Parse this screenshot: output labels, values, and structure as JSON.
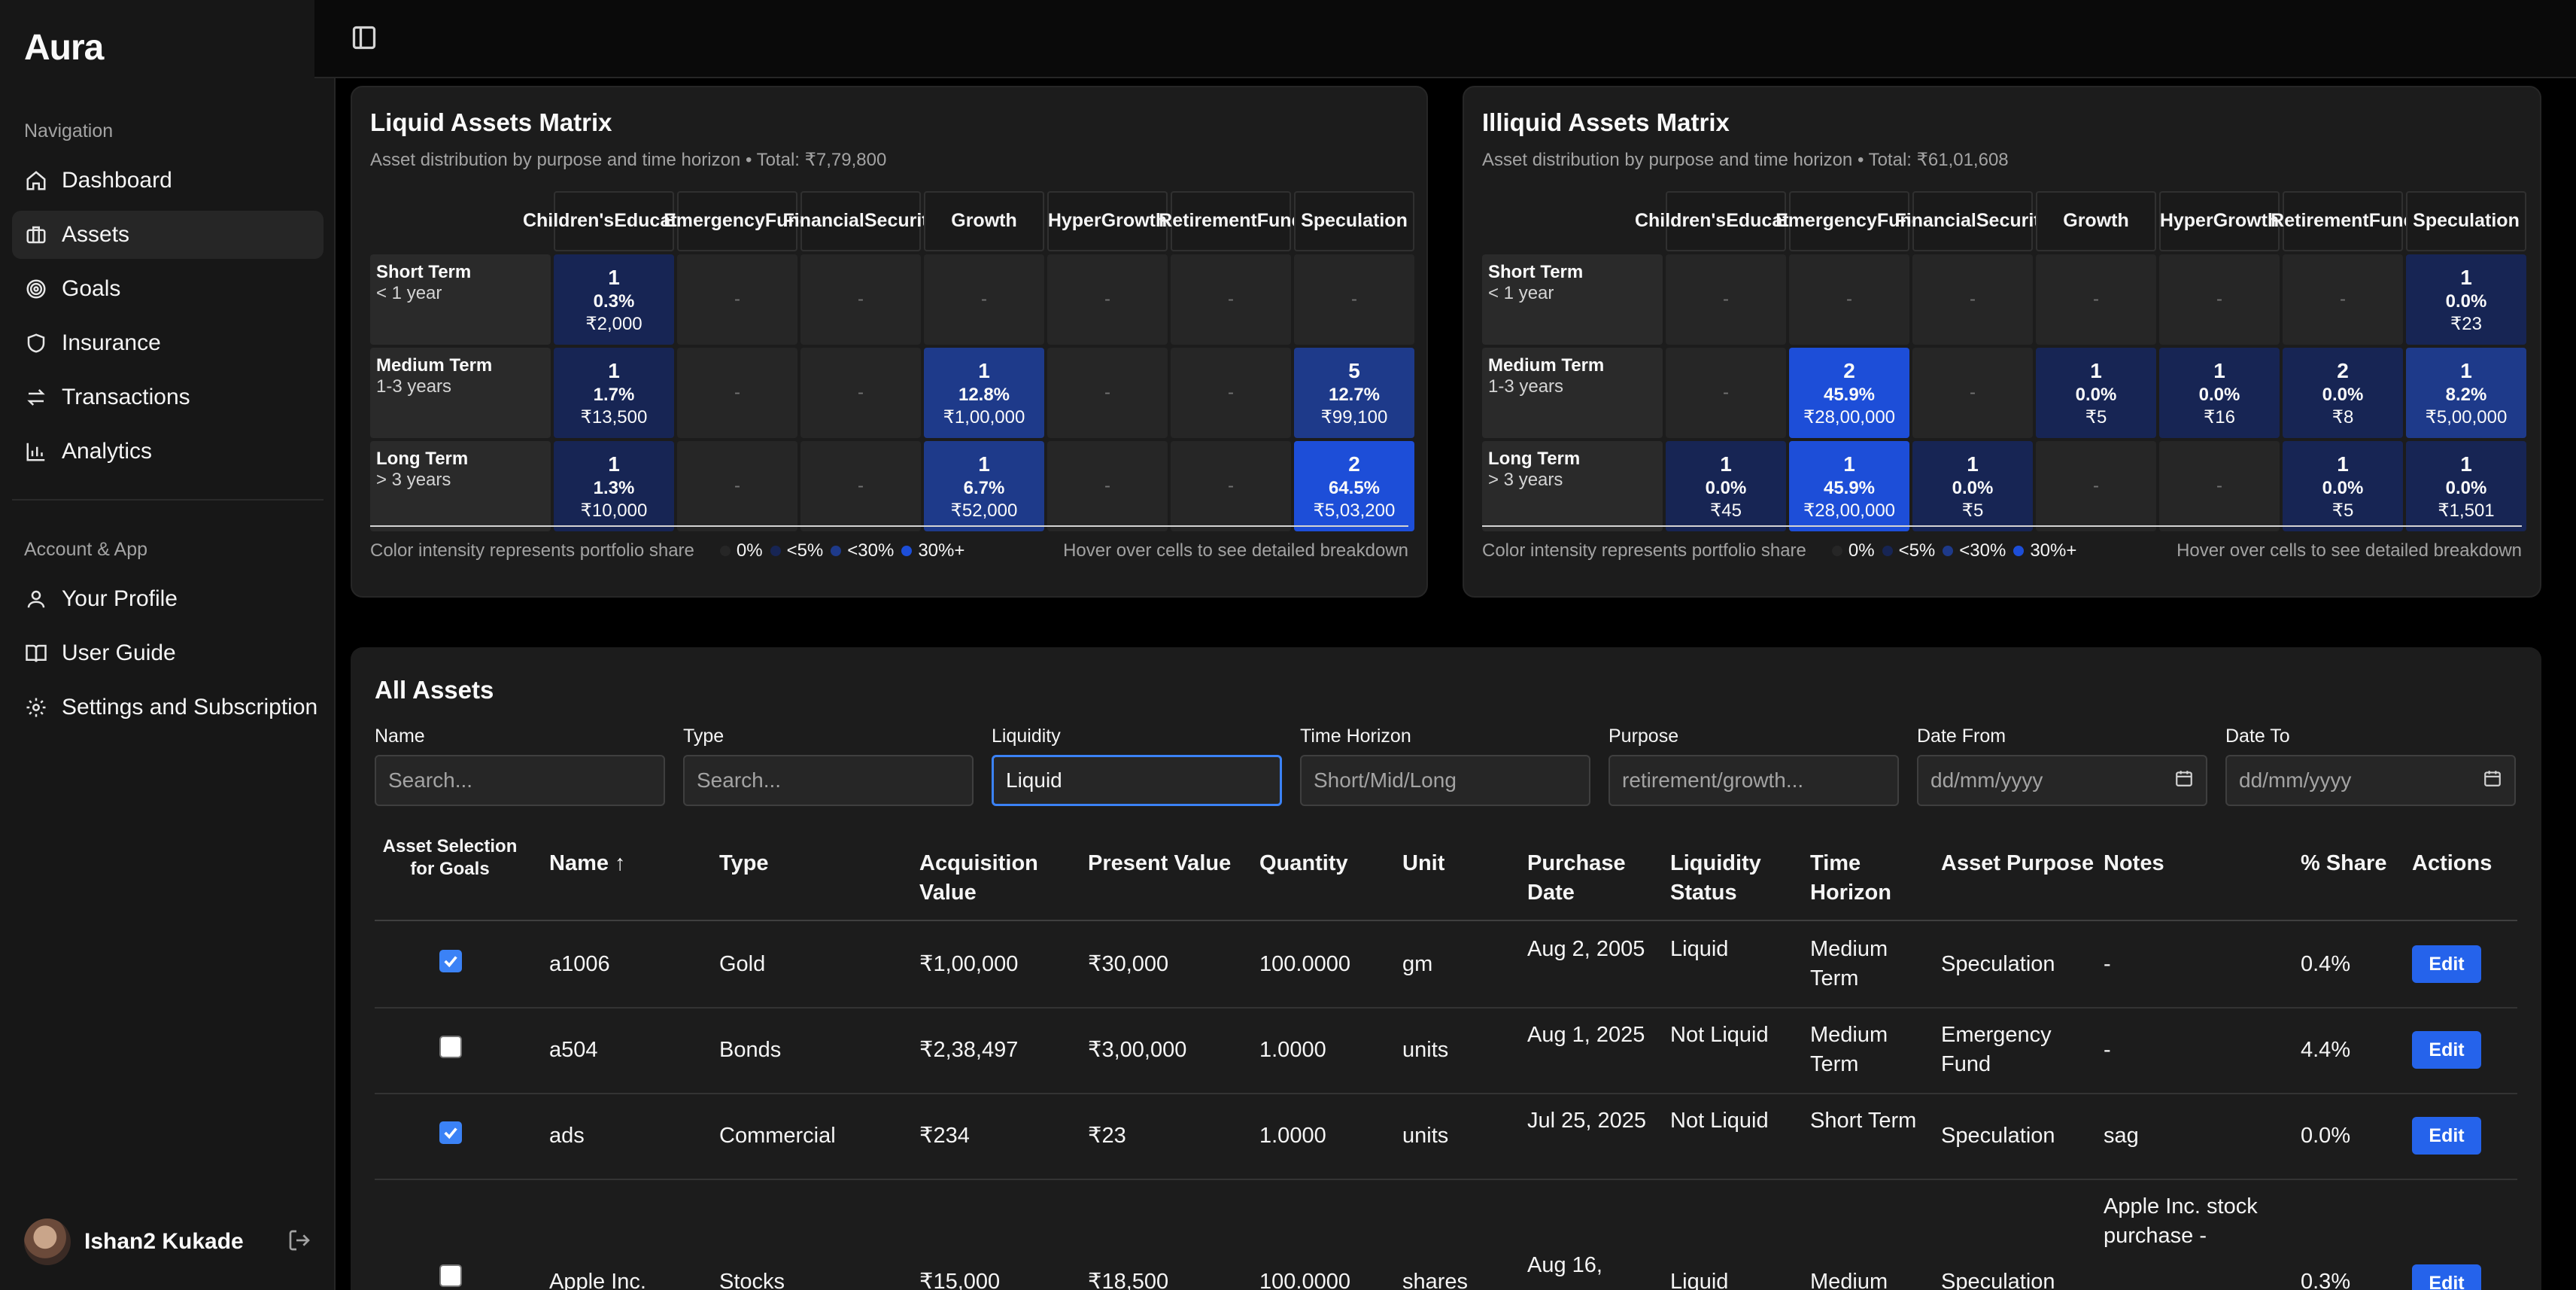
{
  "app": {
    "brand": "Aura"
  },
  "sidebar": {
    "nav_heading": "Navigation",
    "nav_items": [
      {
        "label": "Dashboard",
        "icon": "home-icon"
      },
      {
        "label": "Assets",
        "icon": "briefcase-icon",
        "active": true
      },
      {
        "label": "Goals",
        "icon": "target-icon"
      },
      {
        "label": "Insurance",
        "icon": "shield-icon"
      },
      {
        "label": "Transactions",
        "icon": "arrows-exchange-icon"
      },
      {
        "label": "Analytics",
        "icon": "bar-chart-icon"
      }
    ],
    "account_heading": "Account & App",
    "account_items": [
      {
        "label": "Your Profile",
        "icon": "user-icon"
      },
      {
        "label": "User Guide",
        "icon": "book-icon"
      },
      {
        "label": "Settings and Subscription",
        "icon": "gear-icon"
      }
    ],
    "user": {
      "name": "Ishan2 Kukade"
    }
  },
  "liquid_matrix": {
    "title": "Liquid Assets Matrix",
    "subtitle": "Asset distribution by purpose and time horizon • Total: ₹7,79,800",
    "columns": [
      [
        "Children's",
        "Education"
      ],
      [
        "Emergency",
        "Fund"
      ],
      [
        "Financial",
        "Security"
      ],
      [
        "Growth"
      ],
      [
        "Hyper",
        "Growth"
      ],
      [
        "Retirement",
        "Fund"
      ],
      [
        "Speculation"
      ]
    ],
    "rows": [
      {
        "name": "Short Term",
        "range": "< 1 year",
        "cells": [
          {
            "count": "1",
            "pct": "0.3%",
            "amount": "₹2,000",
            "level": 1
          },
          null,
          null,
          null,
          null,
          null,
          null
        ]
      },
      {
        "name": "Medium Term",
        "range": "1-3 years",
        "cells": [
          {
            "count": "1",
            "pct": "1.7%",
            "amount": "₹13,500",
            "level": 1
          },
          null,
          null,
          {
            "count": "1",
            "pct": "12.8%",
            "amount": "₹1,00,000",
            "level": 2
          },
          null,
          null,
          {
            "count": "5",
            "pct": "12.7%",
            "amount": "₹99,100",
            "level": 2
          }
        ]
      },
      {
        "name": "Long Term",
        "range": "> 3 years",
        "cells": [
          {
            "count": "1",
            "pct": "1.3%",
            "amount": "₹10,000",
            "level": 1
          },
          null,
          null,
          {
            "count": "1",
            "pct": "6.7%",
            "amount": "₹52,000",
            "level": 2
          },
          null,
          null,
          {
            "count": "2",
            "pct": "64.5%",
            "amount": "₹5,03,200",
            "level": 3
          }
        ]
      }
    ],
    "footer_text": "Color intensity represents portfolio share",
    "hover_hint": "Hover over cells to see detailed breakdown"
  },
  "illiquid_matrix": {
    "title": "Illiquid Assets Matrix",
    "subtitle": "Asset distribution by purpose and time horizon • Total: ₹61,01,608",
    "columns": [
      [
        "Children's",
        "Education"
      ],
      [
        "Emergency",
        "Fund"
      ],
      [
        "Financial",
        "Security"
      ],
      [
        "Growth"
      ],
      [
        "Hyper",
        "Growth"
      ],
      [
        "Retirement",
        "Fund"
      ],
      [
        "Speculation"
      ]
    ],
    "rows": [
      {
        "name": "Short Term",
        "range": "< 1 year",
        "cells": [
          null,
          null,
          null,
          null,
          null,
          null,
          {
            "count": "1",
            "pct": "0.0%",
            "amount": "₹23",
            "level": 1
          }
        ]
      },
      {
        "name": "Medium Term",
        "range": "1-3 years",
        "cells": [
          null,
          {
            "count": "2",
            "pct": "45.9%",
            "amount": "₹28,00,000",
            "level": 3
          },
          null,
          {
            "count": "1",
            "pct": "0.0%",
            "amount": "₹5",
            "level": 1
          },
          {
            "count": "1",
            "pct": "0.0%",
            "amount": "₹16",
            "level": 1
          },
          {
            "count": "2",
            "pct": "0.0%",
            "amount": "₹8",
            "level": 1
          },
          {
            "count": "1",
            "pct": "8.2%",
            "amount": "₹5,00,000",
            "level": 2
          }
        ]
      },
      {
        "name": "Long Term",
        "range": "> 3 years",
        "cells": [
          {
            "count": "1",
            "pct": "0.0%",
            "amount": "₹45",
            "level": 1
          },
          {
            "count": "1",
            "pct": "45.9%",
            "amount": "₹28,00,000",
            "level": 3
          },
          {
            "count": "1",
            "pct": "0.0%",
            "amount": "₹5",
            "level": 1
          },
          null,
          null,
          {
            "count": "1",
            "pct": "0.0%",
            "amount": "₹5",
            "level": 1
          },
          {
            "count": "1",
            "pct": "0.0%",
            "amount": "₹1,501",
            "level": 1
          }
        ]
      }
    ],
    "footer_text": "Color intensity represents portfolio share",
    "hover_hint": "Hover over cells to see detailed breakdown"
  },
  "legend": [
    {
      "label": "0%",
      "color": "#262626"
    },
    {
      "label": "<5%",
      "color": "#172554"
    },
    {
      "label": "<30%",
      "color": "#1e3a8a"
    },
    {
      "label": "30%+",
      "color": "#1d4ed8"
    }
  ],
  "empty_cell": "-",
  "assets": {
    "title": "All Assets",
    "filters": [
      {
        "label": "Name",
        "placeholder": "Search...",
        "value": ""
      },
      {
        "label": "Type",
        "placeholder": "Search...",
        "value": ""
      },
      {
        "label": "Liquidity",
        "placeholder": "",
        "value": "Liquid",
        "focused": true
      },
      {
        "label": "Time Horizon",
        "placeholder": "Short/Mid/Long",
        "value": ""
      },
      {
        "label": "Purpose",
        "placeholder": "retirement/growth...",
        "value": ""
      },
      {
        "label": "Date From",
        "placeholder": "dd/mm/yyyy",
        "value": "",
        "date": true
      },
      {
        "label": "Date To",
        "placeholder": "dd/mm/yyyy",
        "value": "",
        "date": true
      }
    ],
    "columns": [
      "Asset Selection for Goals",
      "Name ↑",
      "Type",
      "Acquisition Value",
      "Present Value",
      "Quantity",
      "Unit",
      "Purchase Date",
      "Liquidity Status",
      "Time Horizon",
      "Asset Purpose",
      "Notes",
      "% Share",
      "Actions"
    ],
    "edit_label": "Edit",
    "rows": [
      {
        "selected": true,
        "name": "a1006",
        "type": "Gold",
        "acq": "₹1,00,000",
        "present": "₹30,000",
        "qty": "100.0000",
        "unit": "gm",
        "date": "Aug 2, 2005",
        "liquidity": "Liquid",
        "horizon": "Medium Term",
        "purpose": "Speculation",
        "notes": "-",
        "share": "0.4%"
      },
      {
        "selected": false,
        "name": "a504",
        "type": "Bonds",
        "acq": "₹2,38,497",
        "present": "₹3,00,000",
        "qty": "1.0000",
        "unit": "units",
        "date": "Aug 1, 2025",
        "liquidity": "Not Liquid",
        "horizon": "Medium Term",
        "purpose": "Emergency Fund",
        "notes": "-",
        "share": "4.4%"
      },
      {
        "selected": true,
        "name": "ads",
        "type": "Commercial",
        "acq": "₹234",
        "present": "₹23",
        "qty": "1.0000",
        "unit": "units",
        "date": "Jul 25, 2025",
        "liquidity": "Not Liquid",
        "horizon": "Short Term",
        "purpose": "Speculation",
        "notes": "sag",
        "share": "0.0%"
      },
      {
        "selected": false,
        "name": "Apple Inc.",
        "type": "Stocks",
        "acq": "₹15,000",
        "present": "₹18,500",
        "qty": "100.0000",
        "unit": "shares",
        "date": "Aug 16,",
        "liquidity": "Liquid",
        "horizon": "Medium",
        "purpose": "Speculation",
        "notes": "Apple Inc. stock purchase -",
        "share": "0.3%"
      }
    ]
  }
}
